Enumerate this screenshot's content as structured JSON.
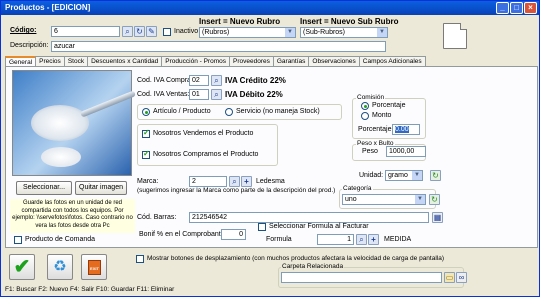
{
  "window": {
    "title": "Productos - [EDICION]"
  },
  "header": {
    "codigo_label": "Código:",
    "codigo_value": "6",
    "inactivo_label": "Inactivo",
    "insert_rubro_label": "Insert = Nuevo Rubro",
    "rubro_value": "(Rubros)",
    "insert_subrubro_label": "Insert = Nuevo Sub Rubro",
    "subrubro_value": "(Sub-Rubros)",
    "descripcion_label": "Descripción:",
    "descripcion_value": "azucar"
  },
  "tabs": [
    "General",
    "Precios",
    "Stock",
    "Descuentos x Cantidad",
    "Producción - Promos",
    "Proveedores",
    "Garantías",
    "Observaciones",
    "Campos Adicionales"
  ],
  "general": {
    "seleccionar_label": "Seleccionar...",
    "quitar_label": "Quitar imagen",
    "photo_note": "Guarde las fotos en un unidad de red compartida con todos los equipos. Por ejemplo: \\\\servefotos\\fotos. Caso contrario no vera las fotos desde otra Pc",
    "comanda_label": "Producto de Comanda",
    "iva_compras_label": "Cod. IVA Compras",
    "iva_compras_value": "02",
    "iva_credito": "IVA Crédito 22%",
    "iva_ventas_label": "Cod. IVA Ventas:",
    "iva_ventas_value": "01",
    "iva_debito": "IVA Débito 22%",
    "tipo_articulo": "Artículo / Producto",
    "tipo_servicio": "Servicio (no maneja Stock)",
    "vendemos": "Nosotros Vendemos el Producto",
    "compramos": "Nosotros Compramos el Producto",
    "comision_title": "Comisión",
    "porcentaje_opt": "Porcentaje",
    "monto_opt": "Monto",
    "porcentaje_label": "Porcentaje",
    "porcentaje_value": "0.00",
    "peso_title": "Peso x Bulto",
    "peso_label": "Peso",
    "peso_value": "1000,00",
    "unidad_label": "Unidad:",
    "unidad_value": "gramo",
    "marca_label": "Marca:",
    "marca_value": "2",
    "marca_name": "Ledesma",
    "marca_hint": "(sugerimos ingresar la Marca como parte de la descripción del prod.)",
    "categoria_title": "Categoría",
    "categoria_value": "uno",
    "barras_label": "Cód. Barras:",
    "barras_value": "212546542",
    "bonif_label": "Bonif % en el Comprobante",
    "bonif_value": "0",
    "formula_chk": "Seleccionar Formula al Facturar",
    "formula_label": "Formula",
    "formula_value": "1",
    "formula_name": "MEDIDA"
  },
  "bottom": {
    "mostrar_label": "Mostrar botones de desplazamiento  (con muchos productos afectara la velocidad de carga de pantalla)",
    "carpeta_title": "Carpeta Relacionada",
    "status": "F1: Buscar  F2: Nuevo  F4: Salir  F10: Guardar  F11: Eliminar"
  },
  "colors": {
    "title": "#0842b8",
    "accent": "#e68b2c",
    "green": "#21a121"
  }
}
